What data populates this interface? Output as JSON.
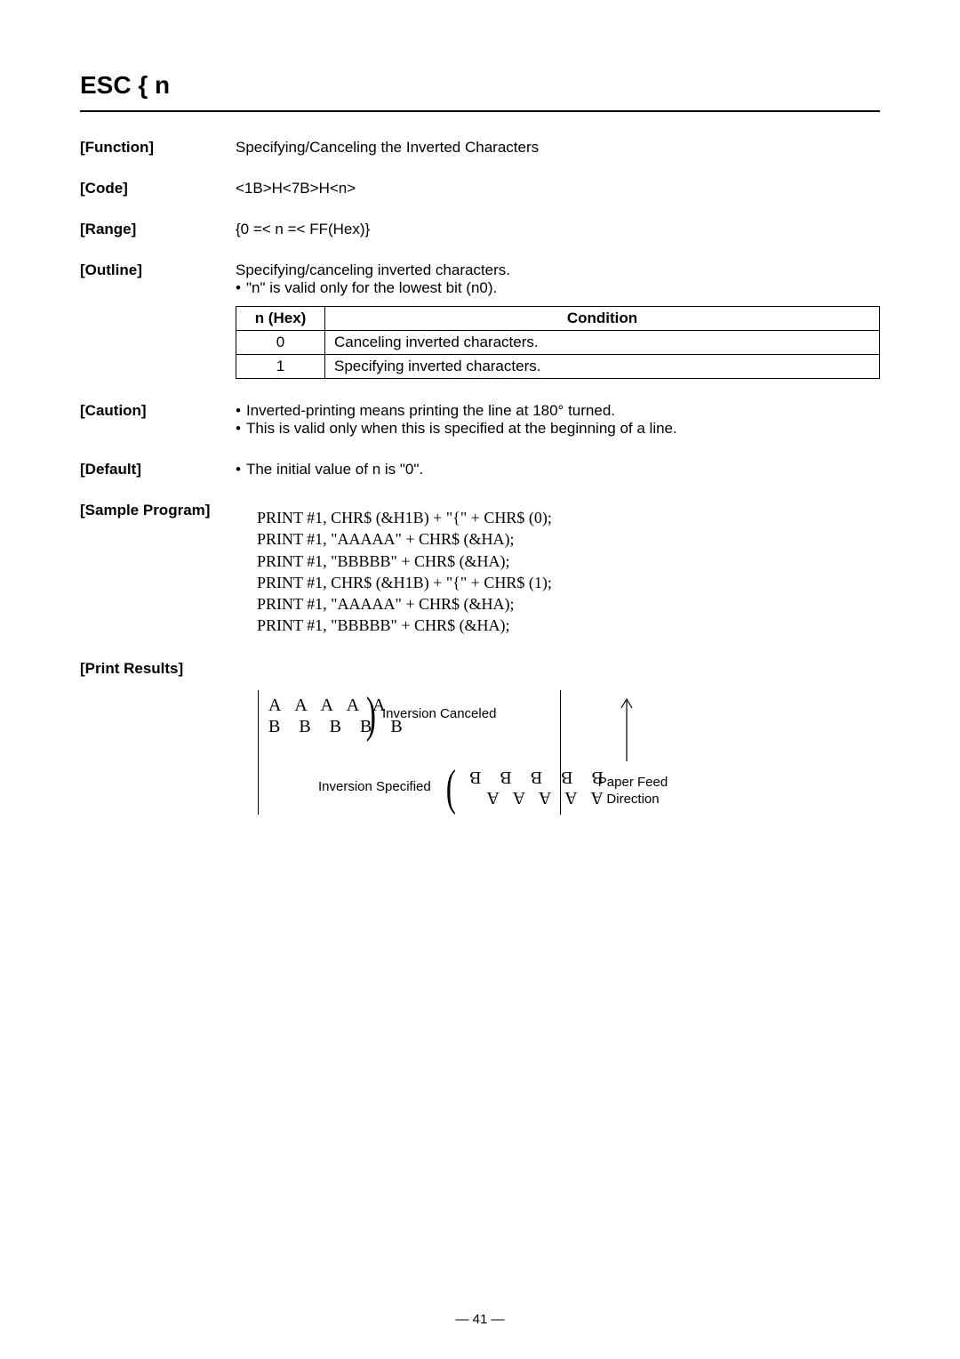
{
  "title": "ESC { n",
  "function": {
    "label": "[Function]",
    "text": "Specifying/Canceling the Inverted Characters"
  },
  "code": {
    "label": "[Code]",
    "text": "<1B>H<7B>H<n>"
  },
  "range": {
    "label": "[Range]",
    "text": "{0 =< n =< FF(Hex)}"
  },
  "outline": {
    "label": "[Outline]",
    "line1": "Specifying/canceling inverted characters.",
    "bullet": "•",
    "line2": "\"n\" is valid only for the lowest bit (n0).",
    "table": {
      "header_n": "n (Hex)",
      "header_cond": "Condition",
      "rows": [
        {
          "n": "0",
          "cond": "Canceling inverted characters."
        },
        {
          "n": "1",
          "cond": "Specifying inverted characters."
        }
      ]
    }
  },
  "caution": {
    "label": "[Caution]",
    "bullet": "•",
    "line1": "Inverted-printing means printing the line at 180° turned.",
    "line2": "This is valid only when this is specified at the beginning of a line."
  },
  "default": {
    "label": "[Default]",
    "bullet": "•",
    "text": "The initial value of n is \"0\"."
  },
  "sample": {
    "label": "[Sample Program]",
    "lines": [
      "PRINT #1, CHR$ (&H1B) + \"{\" + CHR$ (0);",
      "PRINT #1, \"AAAAA\" + CHR$ (&HA);",
      "PRINT #1, \"BBBBB\" + CHR$ (&HA);",
      "PRINT #1, CHR$ (&H1B) + \"{\" + CHR$ (1);",
      "PRINT #1, \"AAAAA\" + CHR$ (&HA);",
      "PRINT #1, \"BBBBB\" + CHR$ (&HA);"
    ]
  },
  "print_results": {
    "label": "[Print Results]",
    "normal_a": "A A A A A",
    "normal_b": "B B B B B",
    "label_canceled": "Inversion Canceled",
    "label_specified": "Inversion Specified",
    "inv_b": "B B B B B",
    "inv_a": "A A A A A",
    "paper_feed": "Paper Feed Direction"
  },
  "page_number": "— 41 —"
}
